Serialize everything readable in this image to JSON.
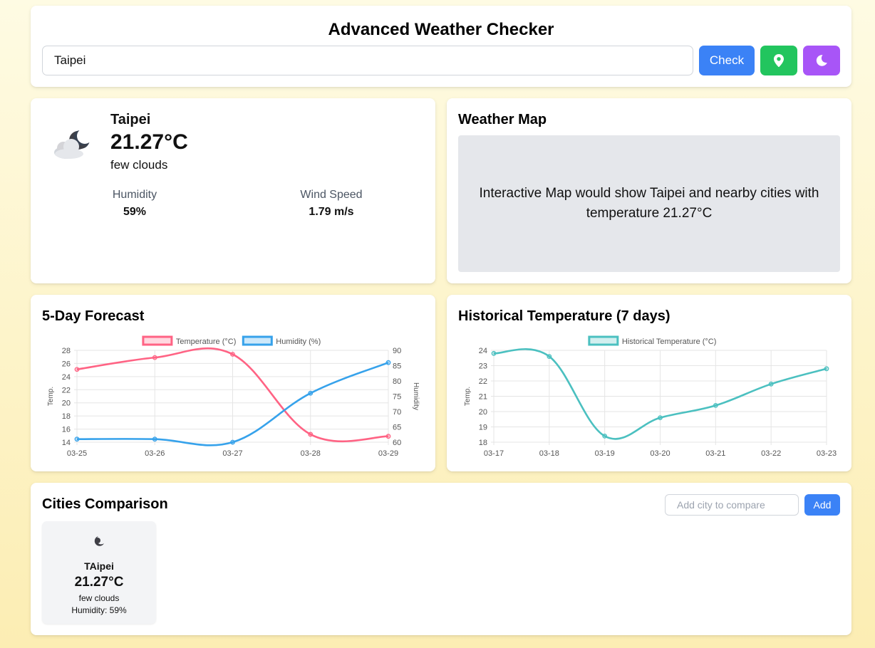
{
  "header": {
    "title": "Advanced Weather Checker",
    "search_value": "Taipei",
    "check_label": "Check",
    "location_icon": "map-pin-icon",
    "dark_icon": "moon-icon"
  },
  "colors": {
    "check": "#3b82f6",
    "location": "#22c55e",
    "dark_mode": "#a855f7",
    "temperature": "#ff6384",
    "humidity": "#36a2eb",
    "historical": "#4bc0c0"
  },
  "current": {
    "icon": "few-clouds-night-icon",
    "city": "Taipei",
    "temp": "21.27°C",
    "description": "few clouds",
    "humidity_label": "Humidity",
    "humidity_value": "59%",
    "wind_label": "Wind Speed",
    "wind_value": "1.79 m/s"
  },
  "map": {
    "title": "Weather Map",
    "text": "Interactive Map would show Taipei and nearby cities with temperature 21.27°C"
  },
  "forecast": {
    "title": "5-Day Forecast"
  },
  "history": {
    "title": "Historical Temperature (7 days)"
  },
  "comparison": {
    "title": "Cities Comparison",
    "placeholder": "Add city to compare",
    "add_label": "Add",
    "cities": [
      {
        "icon": "few-clouds-night-icon",
        "name": "TAipei",
        "temp": "21.27°C",
        "description": "few clouds",
        "humidity": "Humidity: 59%"
      }
    ]
  },
  "chart_data": [
    {
      "type": "line",
      "x": [
        "03-25",
        "03-26",
        "03-27",
        "03-28",
        "03-29"
      ],
      "series": [
        {
          "name": "Temperature (°C)",
          "axis": "left",
          "values": [
            25.1,
            26.9,
            27.4,
            15.2,
            14.9
          ]
        },
        {
          "name": "Humidity (%)",
          "axis": "right",
          "values": [
            61,
            61,
            60,
            76,
            86
          ]
        }
      ],
      "ylabel": "Temp.",
      "y2label": "Humidity",
      "ylim": [
        14,
        28
      ],
      "yticks": [
        14,
        16,
        18,
        20,
        22,
        24,
        26,
        28
      ],
      "y2lim": [
        60,
        90
      ],
      "y2ticks": [
        60,
        65,
        70,
        75,
        80,
        85,
        90
      ],
      "grid": true,
      "legend": "top"
    },
    {
      "type": "line",
      "x": [
        "03-17",
        "03-18",
        "03-19",
        "03-20",
        "03-21",
        "03-22",
        "03-23"
      ],
      "series": [
        {
          "name": "Historical Temperature (°C)",
          "values": [
            23.8,
            23.6,
            18.4,
            19.6,
            20.4,
            21.8,
            22.8
          ]
        }
      ],
      "ylabel": "Temp.",
      "ylim": [
        18,
        24
      ],
      "yticks": [
        18,
        19,
        20,
        21,
        22,
        23,
        24
      ],
      "grid": true,
      "legend": "top"
    }
  ]
}
